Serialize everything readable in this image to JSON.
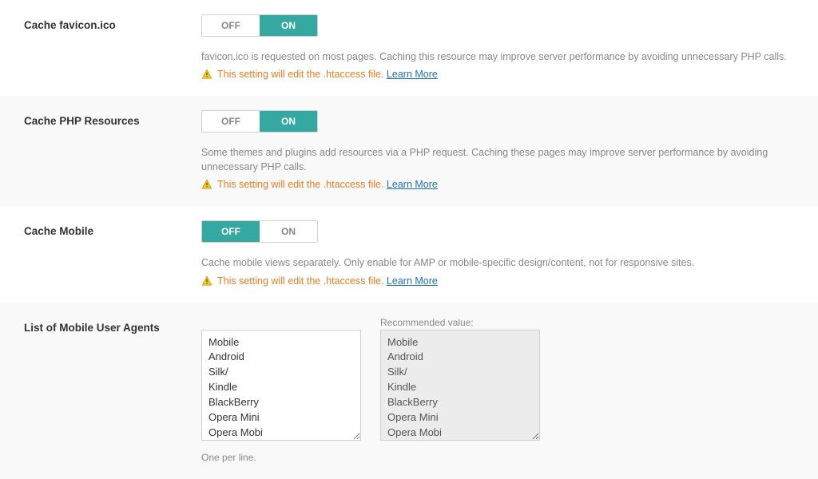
{
  "toggle": {
    "off": "OFF",
    "on": "ON"
  },
  "warning_prefix": "This setting will edit the .htaccess file.",
  "learn_more": "Learn More",
  "settings": {
    "cache_favicon": {
      "label": "Cache favicon.ico",
      "active": "on",
      "desc": "favicon.ico is requested on most pages. Caching this resource may improve server performance by avoiding unnecessary PHP calls."
    },
    "cache_php": {
      "label": "Cache PHP Resources",
      "active": "on",
      "desc": "Some themes and plugins add resources via a PHP request. Caching these pages may improve server performance by avoiding unnecessary PHP calls."
    },
    "cache_mobile": {
      "label": "Cache Mobile",
      "active": "off",
      "desc": "Cache mobile views separately. Only enable for AMP or mobile-specific design/content, not for responsive sites."
    }
  },
  "mobile_agents": {
    "label": "List of Mobile User Agents",
    "value": "Mobile\nAndroid\nSilk/\nKindle\nBlackBerry\nOpera Mini\nOpera Mobi",
    "recommended_label": "Recommended value:",
    "recommended_value": "Mobile\nAndroid\nSilk/\nKindle\nBlackBerry\nOpera Mini\nOpera Mobi",
    "hint": "One per line."
  }
}
